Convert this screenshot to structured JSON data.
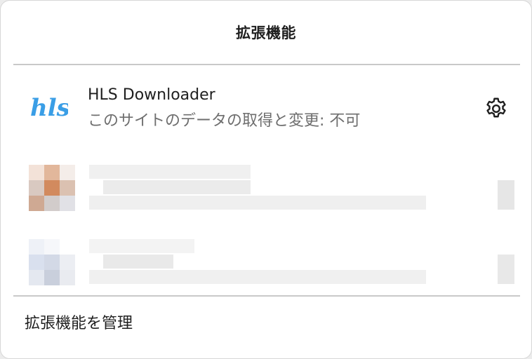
{
  "panel": {
    "title": "拡張機能",
    "manage_label": "拡張機能を管理"
  },
  "extension": {
    "name": "HLS Downloader",
    "site_access": "このサイトのデータの取得と変更: 不可",
    "icon": "hls-logo-icon",
    "icon_text": "hls",
    "icon_color": "#3a9ee6"
  },
  "actions": {
    "settings_icon": "gear-icon"
  },
  "colors": {
    "panel_bg": "#ffffff",
    "divider": "#c9c9c9",
    "secondary_text": "#6e6e6e"
  }
}
